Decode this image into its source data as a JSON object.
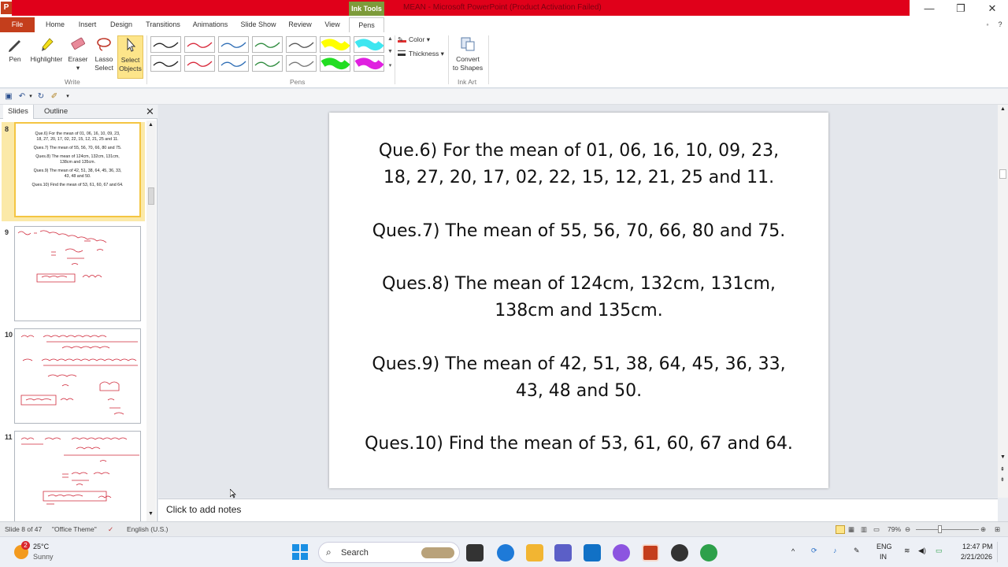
{
  "window": {
    "app_letter": "P",
    "title": "MEAN - Microsoft PowerPoint (Product Activation Failed)",
    "contextual_tab": "Ink Tools",
    "minimize": "—",
    "restore": "❐",
    "close": "✕"
  },
  "ribbon_tabs": [
    "File",
    "Home",
    "Insert",
    "Design",
    "Transitions",
    "Animations",
    "Slide Show",
    "Review",
    "View",
    "Pens"
  ],
  "ribbon": {
    "write_group": {
      "label": "Write",
      "pen": "Pen",
      "highlighter": "Highlighter",
      "eraser": "Eraser",
      "lasso_line1": "Lasso",
      "lasso_line2": "Select",
      "select_line1": "Select",
      "select_line2": "Objects"
    },
    "pens_group_label": "Pens",
    "pen_colors_row1": [
      "#222222",
      "#d8283a",
      "#2d6db5",
      "#2c8a3c",
      "#555555",
      "#ffff00",
      "#3ee6f0"
    ],
    "pen_colors_row2": [
      "#222222",
      "#d8283a",
      "#2d6db5",
      "#2c8a3c",
      "#777777",
      "#22dd22",
      "#e020e0"
    ],
    "ink_color_label": "Color",
    "ink_thickness_label": "Thickness",
    "convert_line1": "Convert",
    "convert_line2": "to Shapes",
    "ink_art_label": "Ink Art"
  },
  "pane": {
    "tab_slides": "Slides",
    "tab_outline": "Outline",
    "close": "✕",
    "thumbnails": [
      {
        "number": "8",
        "lines": [
          "Que.6) For the mean of 01, 06, 16, 10, 09, 23,",
          "18, 27, 20, 17, 02, 22, 15, 12, 21, 25 and 11.",
          "",
          "Ques.7) The mean of 55, 56, 70, 66, 80 and 75.",
          "",
          "Ques.8) The mean of 124cm, 132cm, 131cm,",
          "138cm and 135cm.",
          "",
          "Ques.9) The mean of 42, 51, 38, 64, 45, 36, 33,",
          "43, 48 and 50.",
          "",
          "Ques.10) Find the mean of 53, 61, 60, 67 and 64."
        ]
      },
      {
        "number": "9"
      },
      {
        "number": "10"
      },
      {
        "number": "11"
      }
    ]
  },
  "slide": {
    "lines": [
      "Que.6) For the mean of 01, 06, 16, 10, 09, 23,",
      "18, 27, 20, 17, 02, 22, 15, 12, 21, 25 and 11.",
      "Ques.7) The mean of 55, 56, 70, 66, 80 and 75.",
      "Ques.8) The mean of 124cm, 132cm, 131cm,",
      "138cm and 135cm.",
      "Ques.9) The mean of 42, 51, 38, 64, 45, 36, 33,",
      "43, 48 and 50.",
      "Ques.10) Find the mean of 53, 61, 60, 67 and 64."
    ]
  },
  "notes_placeholder": "Click to add notes",
  "status": {
    "slide_of": "Slide 8 of 47",
    "theme": "\"Office Theme\"",
    "language": "English (U.S.)",
    "zoom": "79%"
  },
  "taskbar": {
    "weather_badge": "2",
    "temperature": "25°C",
    "condition": "Sunny",
    "search_label": "Search",
    "lang_line1": "ENG",
    "lang_line2": "IN",
    "time": "12:47 PM",
    "date": "2/21/2026"
  }
}
